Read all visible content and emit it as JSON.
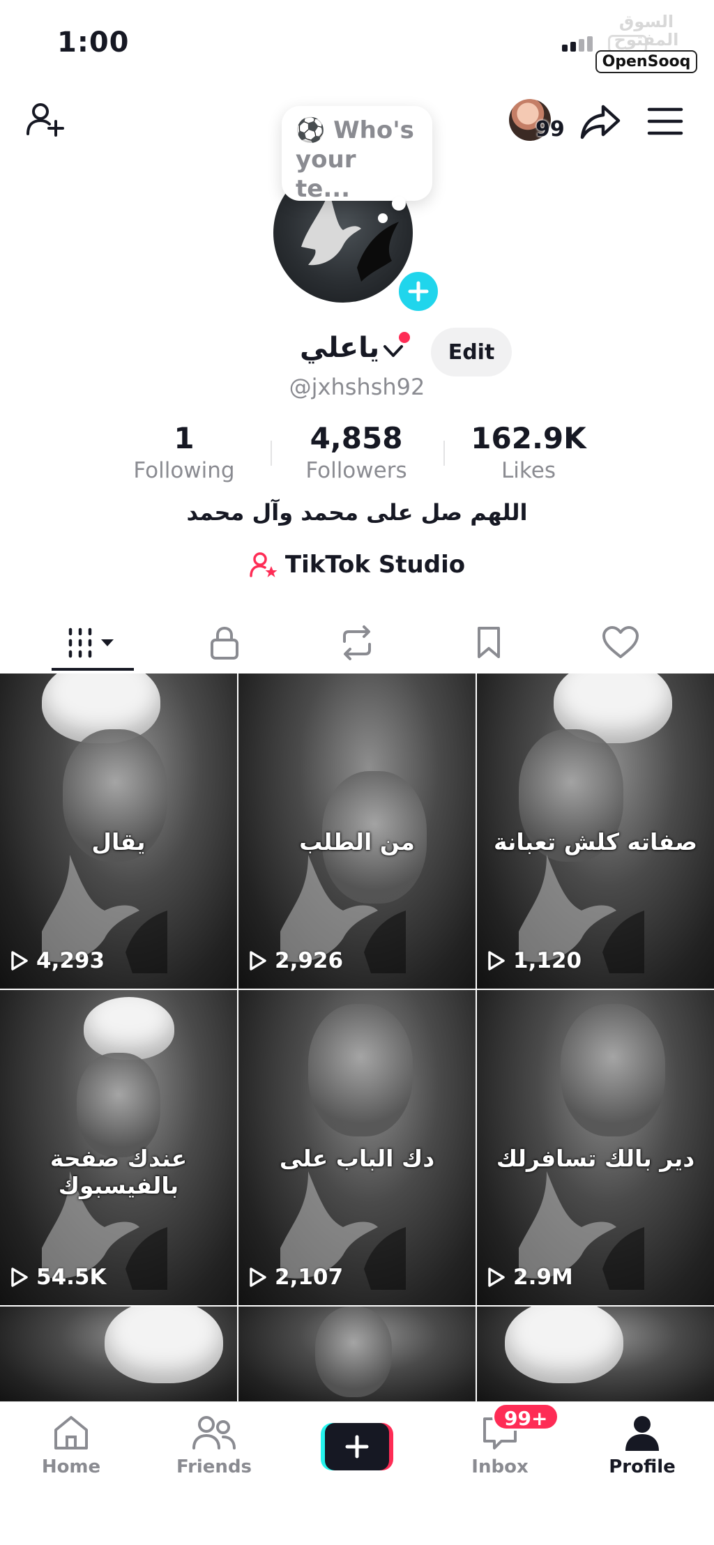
{
  "status_bar": {
    "time": "1:00"
  },
  "watermark": {
    "arabic": "السوق المفتوح",
    "brand": "OpenSooq"
  },
  "header": {
    "avatar_count": "99"
  },
  "bubble": {
    "text": "⚽ Who's\nyour te..."
  },
  "profile": {
    "name": "ياعلي",
    "edit_label": "Edit",
    "username": "@jxhshsh92",
    "bio": "اللهم صل على محمد وآل محمد",
    "studio_label": "TikTok Studio"
  },
  "stats": {
    "following": {
      "value": "1",
      "label": "Following"
    },
    "followers": {
      "value": "4,858",
      "label": "Followers"
    },
    "likes": {
      "value": "162.9K",
      "label": "Likes"
    }
  },
  "videos": [
    {
      "caption": "يقال",
      "views": "4,293"
    },
    {
      "caption": "من الطلب",
      "views": "2,926"
    },
    {
      "caption": "صفاته كلش تعبانة",
      "views": "1,120"
    },
    {
      "caption": "عندك صفحة بالفيسبوك",
      "views": "54.5K"
    },
    {
      "caption": "دك الباب على",
      "views": "2,107"
    },
    {
      "caption": "دير بالك تسافرلك",
      "views": "2.9M"
    }
  ],
  "nav": {
    "home": "Home",
    "friends": "Friends",
    "inbox": "Inbox",
    "inbox_badge": "99+",
    "profile": "Profile"
  },
  "colors": {
    "accent_pink": "#fe2c55",
    "accent_cyan": "#25f4ee",
    "text": "#161823",
    "muted": "#8a8b91"
  }
}
